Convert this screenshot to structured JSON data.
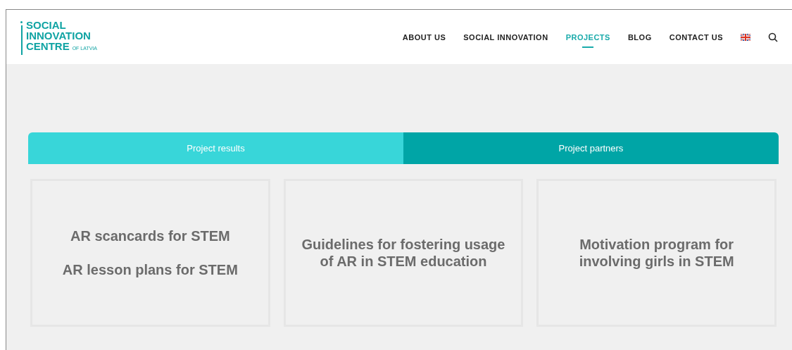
{
  "logo": {
    "lines": [
      "SOCIAL",
      "INNOVATION",
      "CENTRE"
    ],
    "suffix": "OF LATVIA"
  },
  "nav": [
    {
      "label": "ABOUT US",
      "selected": false
    },
    {
      "label": "SOCIAL INNOVATION",
      "selected": false
    },
    {
      "label": "PROJECTS",
      "selected": true
    },
    {
      "label": "BLOG",
      "selected": false
    },
    {
      "label": "CONTACT US",
      "selected": false
    }
  ],
  "tabs": [
    {
      "label": "Project results",
      "selected": true
    },
    {
      "label": "Project partners",
      "selected": false
    }
  ],
  "cards": [
    {
      "titles": [
        "AR scancards for STEM",
        "AR lesson plans for STEM"
      ]
    },
    {
      "titles": [
        "Guidelines for fostering usage of AR in STEM education"
      ]
    },
    {
      "titles": [
        "Motivation program for involving girls in STEM"
      ]
    }
  ]
}
